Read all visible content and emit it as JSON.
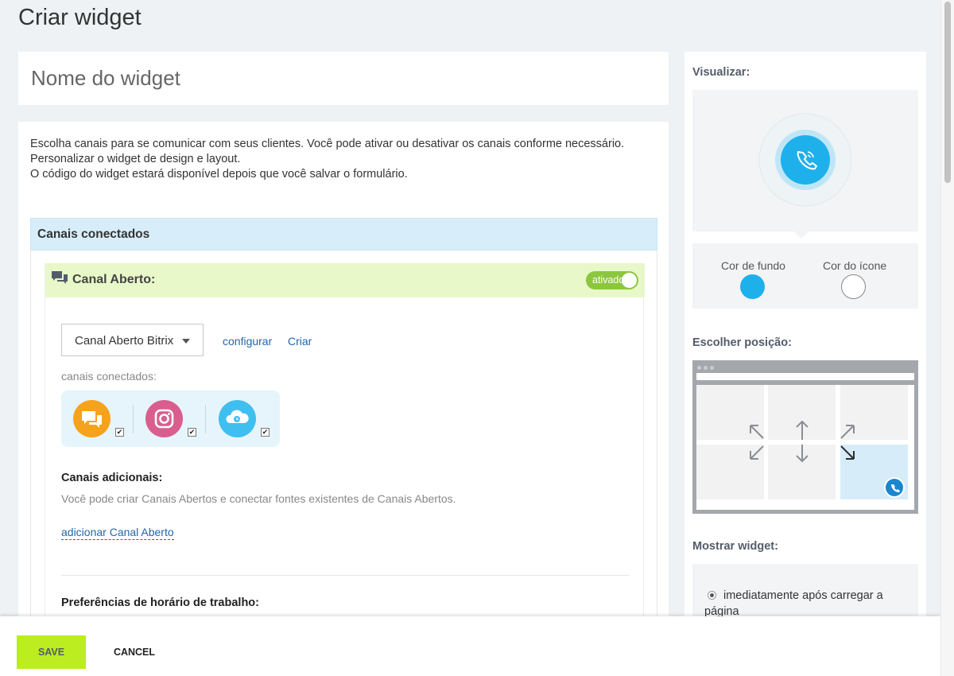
{
  "page": {
    "title": "Criar widget"
  },
  "name_field": {
    "placeholder": "Nome do widget"
  },
  "intro": {
    "line1": "Escolha canais para se comunicar com seus clientes. Você pode ativar ou desativar os canais conforme necessário.",
    "line2": "Personalizar o widget de design e layout.",
    "line3": "O código do widget estará disponível depois que você salvar o formulário."
  },
  "connected": {
    "header": "Canais conectados",
    "channel": {
      "title": "Canal Aberto:",
      "toggle_label": "ativado",
      "toggle_on": true,
      "selected": "Canal Aberto Bitrix",
      "configure_link": "configurar",
      "create_link": "Criar",
      "connected_label": "canais conectados:",
      "sources": [
        {
          "icon": "chat-icon",
          "color": "#f7a21b",
          "checked": true
        },
        {
          "icon": "instagram-icon",
          "color": "#d95e8e",
          "checked": true
        },
        {
          "icon": "cloud-clock-icon",
          "color": "#3fbff0",
          "checked": true
        }
      ]
    },
    "additional": {
      "title": "Canais adicionais:",
      "description": "Você pode criar Canais Abertos e conectar fontes existentes de Canais Abertos.",
      "add_link": "adicionar Canal Aberto"
    },
    "work_hours_title": "Preferências de horário de trabalho:"
  },
  "side": {
    "preview_label": "Visualizar:",
    "bg_color_label": "Cor de fundo",
    "icon_color_label": "Cor do ícone",
    "bg_color": "#1eb0eb",
    "icon_color": "#ffffff",
    "position_label": "Escolher posição:",
    "selected_position": "bottom-right",
    "show_label": "Mostrar widget:",
    "show_option": "imediatamente após carregar a página"
  },
  "footer": {
    "save": "SAVE",
    "cancel": "CANCEL"
  }
}
